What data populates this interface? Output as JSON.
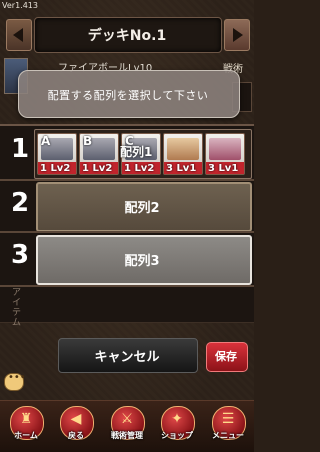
{
  "version": "Ver1.413",
  "header": {
    "deck_title": "デッキNo.1",
    "card_name": "ファイアボールLv10",
    "tactics_label": "戦術"
  },
  "prompt": {
    "text": "配置する配列を選択して下さい"
  },
  "formations": [
    {
      "number": "1",
      "label": "配列1",
      "units": [
        {
          "letter": "A",
          "level": "1 Lv2"
        },
        {
          "letter": "B",
          "level": "1 Lv2"
        },
        {
          "letter": "C",
          "level": "1 Lv2"
        },
        {
          "letter": "",
          "level": "3 Lv1"
        },
        {
          "letter": "",
          "level": "3 Lv1"
        }
      ]
    },
    {
      "number": "2",
      "label": "配列2"
    },
    {
      "number": "3",
      "label": "配列3"
    }
  ],
  "item_label": "アイテム",
  "actions": {
    "cancel": "キャンセル",
    "save": "保存"
  },
  "bottom_nav": [
    {
      "label": "ホーム",
      "icon": "castle-icon"
    },
    {
      "label": "戻る",
      "icon": "back-arrow-icon"
    },
    {
      "label": "戦術管理",
      "icon": "tactics-icon"
    },
    {
      "label": "ショップ",
      "icon": "shop-icon"
    },
    {
      "label": "メニュー",
      "icon": "menu-icon"
    }
  ],
  "colors": {
    "accent_red": "#c0242c",
    "panel_dark": "#1c1511"
  }
}
